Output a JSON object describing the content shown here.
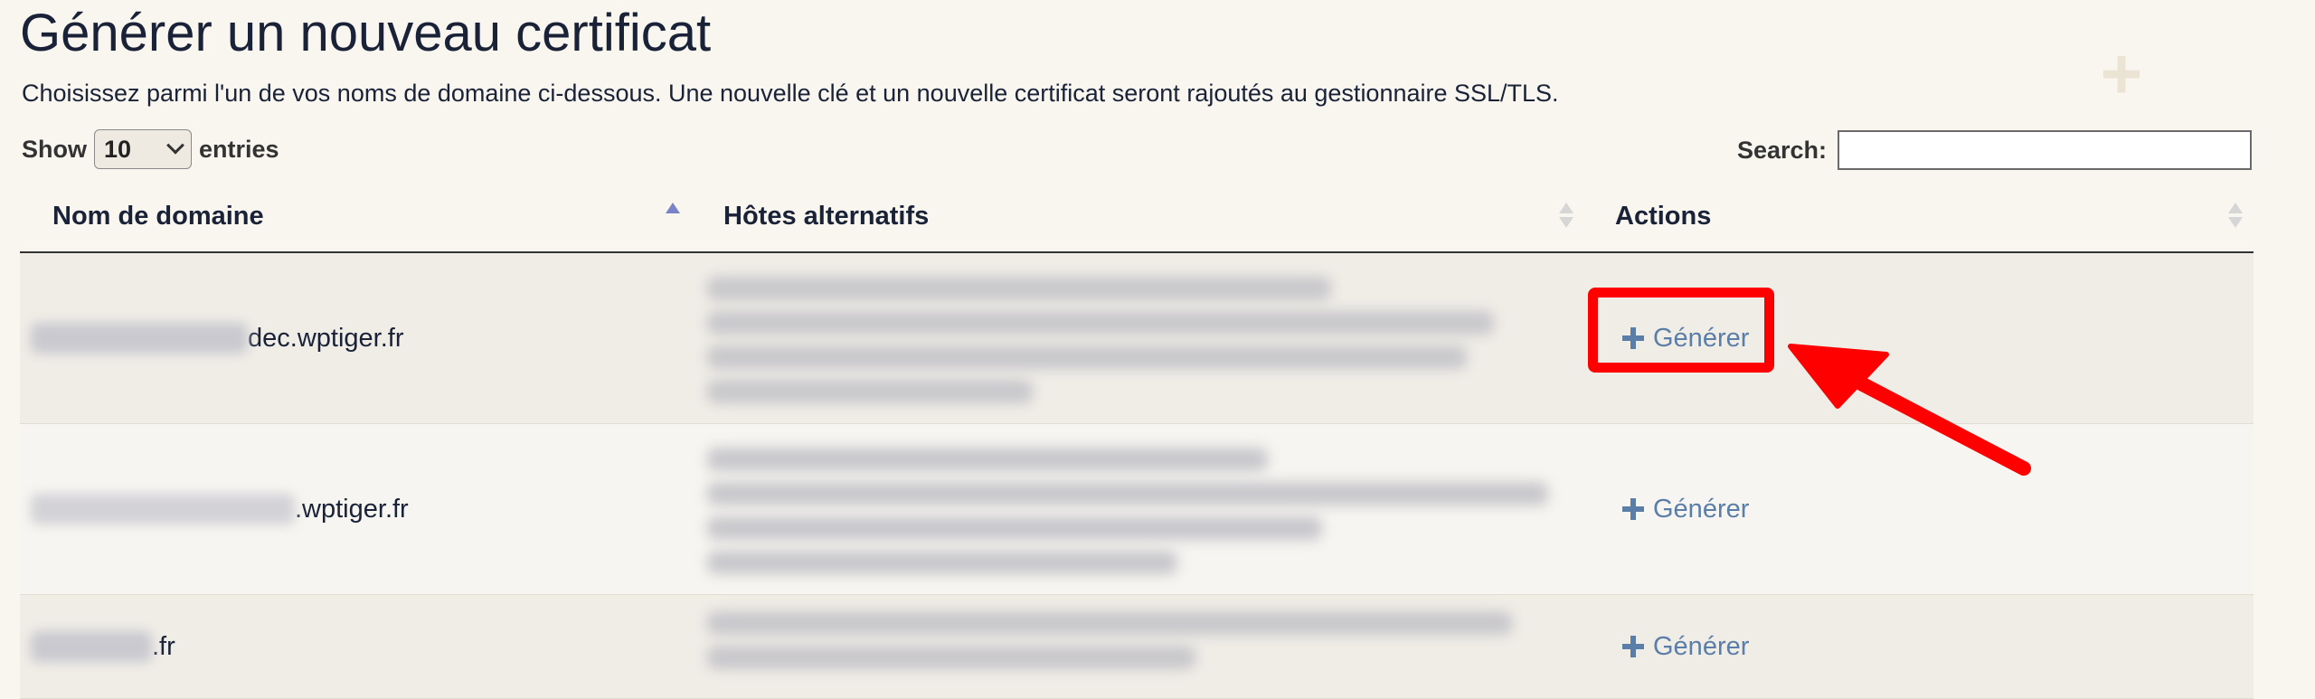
{
  "header": {
    "title": "Générer un nouveau certificat",
    "subtitle": "Choisissez parmi l'un de vos noms de domaine ci-dessous. Une nouvelle clé et un nouvelle certificat seront rajoutés au gestionnaire SSL/TLS."
  },
  "controls": {
    "show_label": "Show",
    "entries_value": "10",
    "entries_label": "entries",
    "search_label": "Search:",
    "search_value": ""
  },
  "table": {
    "columns": [
      "Nom de domaine",
      "Hôtes alternatifs",
      "Actions"
    ],
    "rows": [
      {
        "domain_suffix": "dec.wptiger.fr",
        "action": "Générer"
      },
      {
        "domain_suffix": ".wptiger.fr",
        "action": "Générer"
      },
      {
        "domain_suffix": ".fr",
        "action": "Générer"
      }
    ]
  },
  "colors": {
    "accent_link": "#5a7ea8",
    "highlight": "#ff0000"
  }
}
